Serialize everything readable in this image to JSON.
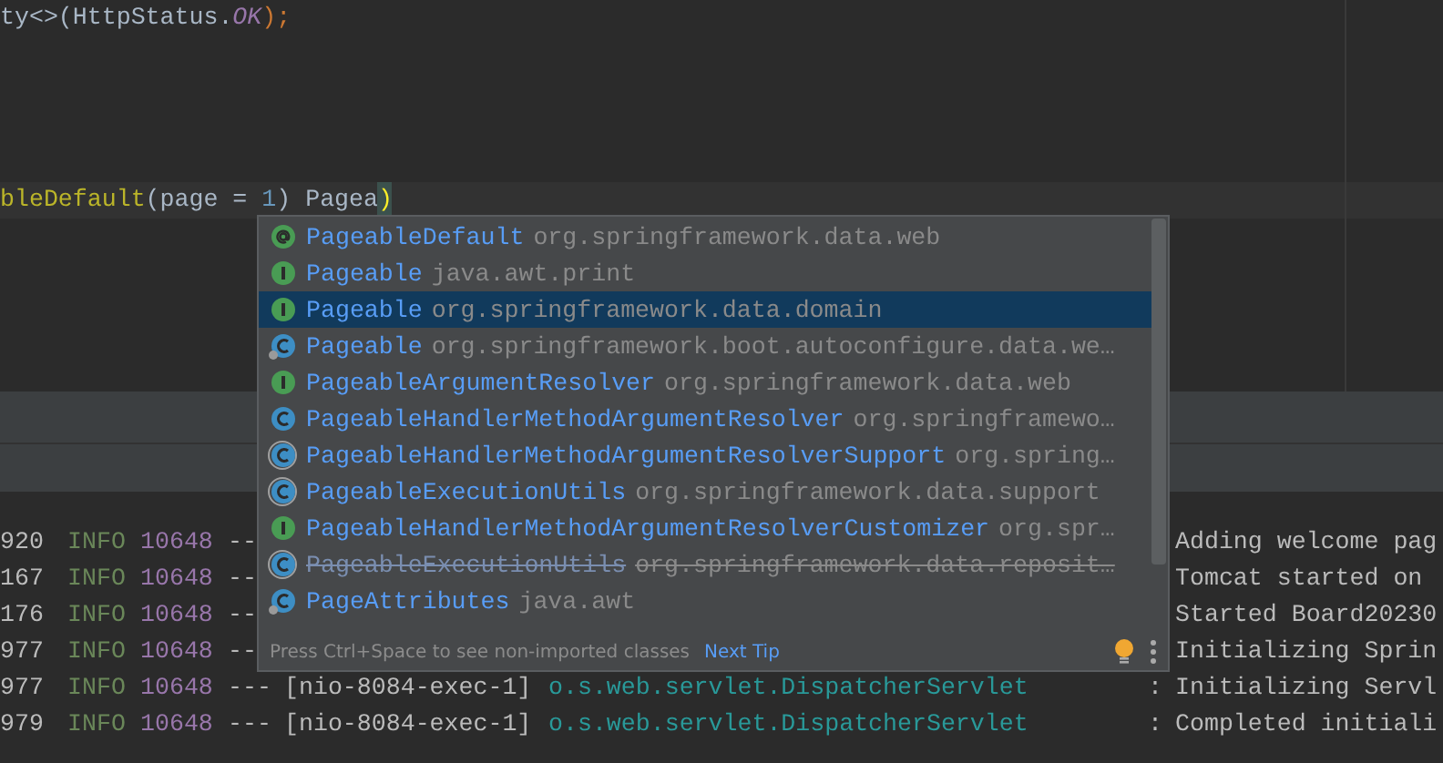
{
  "editor": {
    "top_line": [
      {
        "kind": "plain",
        "text": "ty<>(HttpStatus."
      },
      {
        "kind": "constant",
        "text": "OK"
      },
      {
        "kind": "punct",
        "text": ");"
      }
    ],
    "current_line": [
      {
        "kind": "annotation",
        "text": "bleDefault"
      },
      {
        "kind": "plain",
        "text": "(page = "
      },
      {
        "kind": "number",
        "text": "1"
      },
      {
        "kind": "plain",
        "text": ") Pagea"
      },
      {
        "kind": "brace",
        "text": ")"
      }
    ]
  },
  "completion": {
    "items": [
      {
        "kind": "annotation",
        "name": "PageableDefault",
        "package": "org.springframework.data.web",
        "selected": false,
        "deprecated": false
      },
      {
        "kind": "interface",
        "name": "Pageable",
        "package": "java.awt.print",
        "selected": false,
        "deprecated": false
      },
      {
        "kind": "interface",
        "name": "Pageable",
        "package": "org.springframework.data.domain",
        "selected": true,
        "deprecated": false
      },
      {
        "kind": "class-badge",
        "name": "Pageable",
        "package": "org.springframework.boot.autoconfigure.data.we…",
        "selected": false,
        "deprecated": false
      },
      {
        "kind": "interface",
        "name": "PageableArgumentResolver",
        "package": "org.springframework.data.web",
        "selected": false,
        "deprecated": false
      },
      {
        "kind": "class",
        "name": "PageableHandlerMethodArgumentResolver",
        "package": "org.springframewo…",
        "selected": false,
        "deprecated": false
      },
      {
        "kind": "abstract",
        "name": "PageableHandlerMethodArgumentResolverSupport",
        "package": "org.spring…",
        "selected": false,
        "deprecated": false
      },
      {
        "kind": "abstract",
        "name": "PageableExecutionUtils",
        "package": "org.springframework.data.support",
        "selected": false,
        "deprecated": false
      },
      {
        "kind": "interface",
        "name": "PageableHandlerMethodArgumentResolverCustomizer",
        "package": "org.spr…",
        "selected": false,
        "deprecated": false
      },
      {
        "kind": "abstract",
        "name": "PageableExecutionUtils",
        "package": "org.springframework.data.reposit…",
        "selected": false,
        "deprecated": true
      },
      {
        "kind": "class-badge",
        "name": "PageAttributes",
        "package": "java.awt",
        "selected": false,
        "deprecated": false
      }
    ],
    "hint": "Press Ctrl+Space to see non-imported classes",
    "link": "Next Tip"
  },
  "console": {
    "rows": [
      {
        "time": "920",
        "level": "INFO",
        "pid": "10648",
        "sep": "--",
        "message": "Adding welcome pag"
      },
      {
        "time": "167",
        "level": "INFO",
        "pid": "10648",
        "sep": "--",
        "message": "Tomcat started on"
      },
      {
        "time": "176",
        "level": "INFO",
        "pid": "10648",
        "sep": "--",
        "message": "Started Board20230"
      },
      {
        "time": "977",
        "level": "INFO",
        "pid": "10648",
        "sep": "--",
        "message": "Initializing Sprin"
      },
      {
        "time": "977",
        "level": "INFO",
        "pid": "10648",
        "sep": "---",
        "thread": "[nio-8084-exec-1]",
        "logger": "o.s.web.servlet.DispatcherServlet",
        "colon": ":",
        "message": "Initializing Servl"
      },
      {
        "time": "979",
        "level": "INFO",
        "pid": "10648",
        "sep": "---",
        "thread": "[nio-8084-exec-1]",
        "logger": "o.s.web.servlet.DispatcherServlet",
        "colon": ":",
        "message": "Completed initiali"
      }
    ]
  }
}
